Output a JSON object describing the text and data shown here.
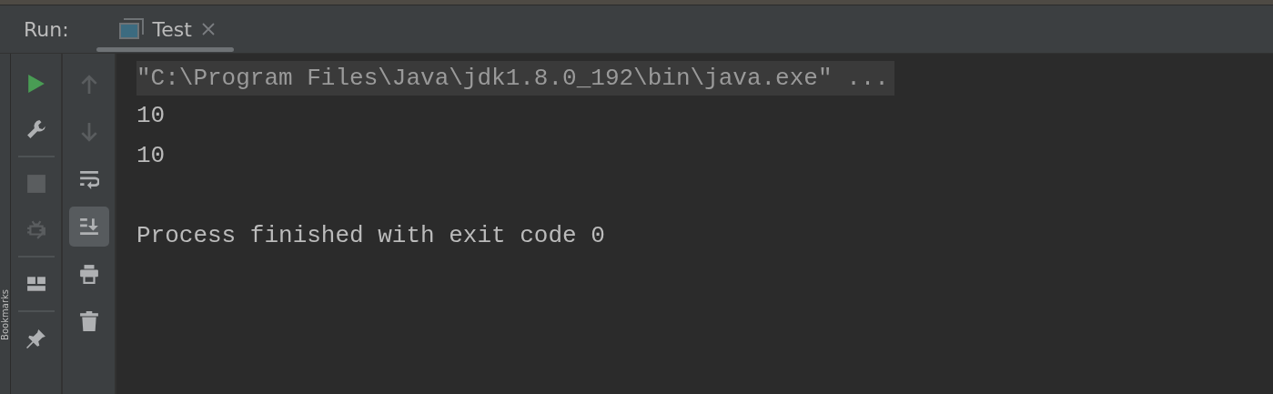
{
  "side_tab": {
    "label": "Bookmarks"
  },
  "run_panel": {
    "label": "Run:",
    "tabs": [
      {
        "label": "Test",
        "selected": true,
        "closable": true
      }
    ],
    "actions": [
      {
        "kind": "rerun",
        "disabled": false
      },
      {
        "kind": "settings",
        "disabled": false
      },
      {
        "kind": "divider"
      },
      {
        "kind": "stop",
        "disabled": true
      },
      {
        "kind": "attach",
        "disabled": true
      },
      {
        "kind": "divider"
      },
      {
        "kind": "layout",
        "disabled": false
      },
      {
        "kind": "divider"
      },
      {
        "kind": "pin",
        "disabled": false
      }
    ],
    "console_tools": [
      {
        "kind": "up",
        "disabled": true,
        "selected": false
      },
      {
        "kind": "down",
        "disabled": true,
        "selected": false
      },
      {
        "kind": "wrap",
        "disabled": false,
        "selected": false
      },
      {
        "kind": "scroll",
        "disabled": false,
        "selected": true
      },
      {
        "kind": "print",
        "disabled": false,
        "selected": false
      },
      {
        "kind": "clear",
        "disabled": false,
        "selected": false
      }
    ],
    "console": [
      {
        "kind": "command",
        "text": "\"C:\\Program Files\\Java\\jdk1.8.0_192\\bin\\java.exe\" ..."
      },
      {
        "kind": "output",
        "text": "10"
      },
      {
        "kind": "output",
        "text": "10"
      },
      {
        "kind": "status",
        "text": "Process finished with exit code 0"
      }
    ]
  }
}
